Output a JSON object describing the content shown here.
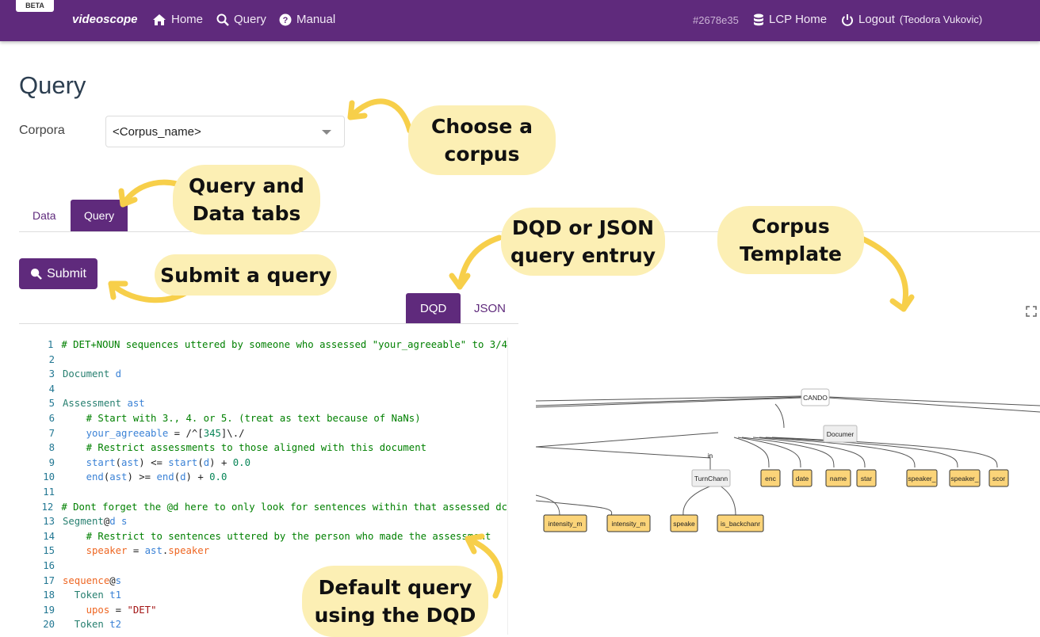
{
  "nav": {
    "beta": "BETA",
    "brand": "videoscope",
    "home": "Home",
    "query": "Query",
    "manual": "Manual",
    "hash": "#2678e35",
    "lcp_home": "LCP Home",
    "logout": "Logout",
    "user": "(Teodora Vukovic)"
  },
  "page": {
    "title": "Query",
    "corpora_label": "Corpora",
    "corpus_value": "<Corpus_name>"
  },
  "tabs": [
    {
      "label": "Data",
      "active": false
    },
    {
      "label": "Query",
      "active": true
    }
  ],
  "submit_label": "Submit",
  "editor_tabs": [
    {
      "label": "DQD",
      "active": true
    },
    {
      "label": "JSON",
      "active": false
    }
  ],
  "code_lines": [
    [
      [
        "# DET+NOUN sequences uttered by someone who assessed \"your_agreeable\" to 3/4",
        "com"
      ]
    ],
    [],
    [
      [
        "Document ",
        "kw"
      ],
      [
        "d",
        "var"
      ]
    ],
    [],
    [
      [
        "Assessment ",
        "kw"
      ],
      [
        "ast",
        "var"
      ]
    ],
    [
      [
        "    # Start with 3., 4. or 5. (treat as text because of NaNs)",
        "com"
      ]
    ],
    [
      [
        "    your_agreeable",
        "var"
      ],
      [
        " = /^[",
        "op"
      ],
      [
        "345",
        "num"
      ],
      [
        "]\\./",
        "op"
      ]
    ],
    [
      [
        "    # Restrict assessments to those aligned with this document",
        "com"
      ]
    ],
    [
      [
        "    start",
        "var"
      ],
      [
        "(",
        "op"
      ],
      [
        "ast",
        "var"
      ],
      [
        ") <= ",
        "op"
      ],
      [
        "start",
        "var"
      ],
      [
        "(",
        "op"
      ],
      [
        "d",
        "var"
      ],
      [
        ") + ",
        "op"
      ],
      [
        "0.0",
        "num"
      ]
    ],
    [
      [
        "    end",
        "var"
      ],
      [
        "(",
        "op"
      ],
      [
        "ast",
        "var"
      ],
      [
        ") >= ",
        "op"
      ],
      [
        "end",
        "var"
      ],
      [
        "(",
        "op"
      ],
      [
        "d",
        "var"
      ],
      [
        ") + ",
        "op"
      ],
      [
        "0.0",
        "num"
      ]
    ],
    [],
    [
      [
        "# Dont forget the @d here to only look for sentences within that assessed dc",
        "com"
      ]
    ],
    [
      [
        "Segment",
        "kw"
      ],
      [
        "@",
        "op"
      ],
      [
        "d",
        "var"
      ],
      [
        " s",
        "var"
      ]
    ],
    [
      [
        "    # Restrict to sentences uttered by the person who made the assessment",
        "com"
      ]
    ],
    [
      [
        "    speaker",
        "at"
      ],
      [
        " = ",
        "op"
      ],
      [
        "ast",
        "var"
      ],
      [
        ".",
        "op"
      ],
      [
        "speaker",
        "at"
      ]
    ],
    [],
    [
      [
        "sequence",
        "at"
      ],
      [
        "@",
        "op"
      ],
      [
        "s",
        "var"
      ]
    ],
    [
      [
        "  Token ",
        "kw"
      ],
      [
        "t1",
        "var"
      ]
    ],
    [
      [
        "    upos",
        "at"
      ],
      [
        " = ",
        "op"
      ],
      [
        "\"DET\"",
        "str"
      ]
    ],
    [
      [
        "  Token ",
        "kw"
      ],
      [
        "t2",
        "var"
      ]
    ]
  ],
  "graph": {
    "nodes": {
      "cando": "CANDO",
      "document": "Documer",
      "turn": "TurnChann",
      "edge_label": "in",
      "doc_attrs": [
        "enc",
        "date",
        "name",
        "star",
        "speaker_",
        "speaker_",
        "scor"
      ],
      "turn_attrs": [
        "speake",
        "is_backchanr"
      ],
      "left_attrs": [
        "intensity_m",
        "intensity_m"
      ]
    }
  },
  "callouts": {
    "corpus": "Choose a corpus",
    "tabs": "Query and Data tabs",
    "submit": "Submit a query",
    "dqd": "DQD or JSON query entruy",
    "template": "Corpus Template",
    "default": "Default query using the DQD"
  },
  "colors": {
    "brand": "#5f2a7c",
    "callout": "#fcefb4",
    "arrow": "#f7cf4a",
    "attr_node": "#fbd479"
  }
}
